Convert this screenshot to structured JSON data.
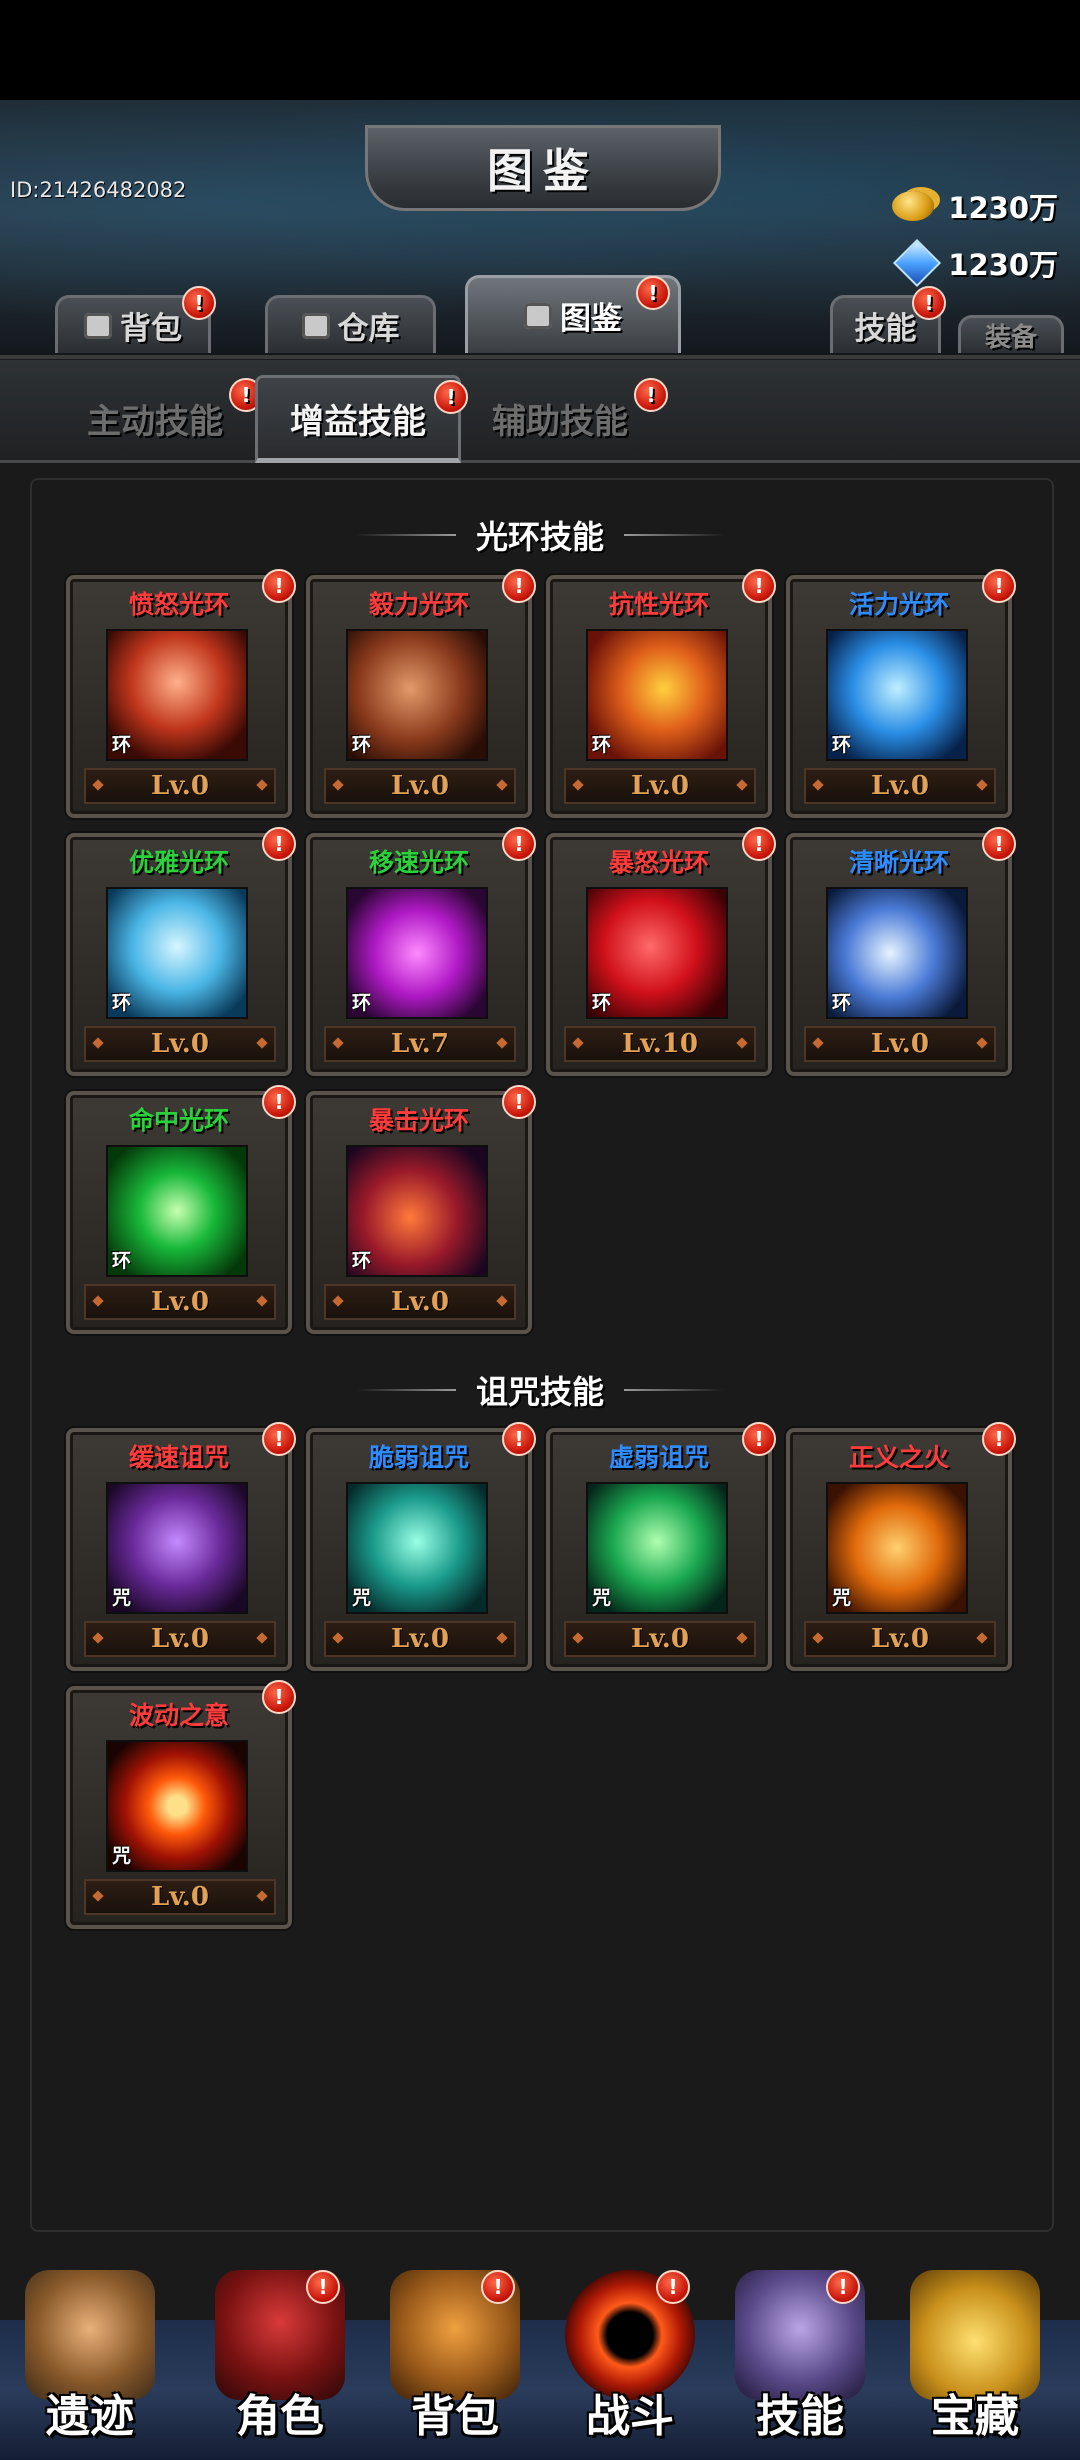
{
  "header": {
    "title": "图鉴",
    "player_id": "ID:21426482082",
    "gold": "1230万",
    "gems": "1230万"
  },
  "top_tabs": [
    {
      "label": "背包",
      "badge": "!"
    },
    {
      "label": "仓库"
    },
    {
      "label": "图鉴",
      "badge": "!",
      "active": true
    },
    {
      "label": "技能",
      "badge": "!"
    },
    {
      "label": "装备"
    }
  ],
  "sub_tabs": [
    {
      "label": "主动技能",
      "badge": "!"
    },
    {
      "label": "增益技能",
      "badge": "!",
      "active": true
    },
    {
      "label": "辅助技能",
      "badge": "!"
    }
  ],
  "sections": [
    {
      "title": "光环技能",
      "skills": [
        {
          "name": "愤怒光环",
          "name_color": "#ff3b3b",
          "tag": "环",
          "level": "Lv.0",
          "badge": "!"
        },
        {
          "name": "毅力光环",
          "name_color": "#ff3b3b",
          "tag": "环",
          "level": "Lv.0",
          "badge": "!"
        },
        {
          "name": "抗性光环",
          "name_color": "#ff3b3b",
          "tag": "环",
          "level": "Lv.0",
          "badge": "!"
        },
        {
          "name": "活力光环",
          "name_color": "#2f8cff",
          "tag": "环",
          "level": "Lv.0",
          "badge": "!"
        },
        {
          "name": "优雅光环",
          "name_color": "#2bd13a",
          "tag": "环",
          "level": "Lv.0",
          "badge": "!"
        },
        {
          "name": "移速光环",
          "name_color": "#2bd13a",
          "tag": "环",
          "level": "Lv.7",
          "badge": "!"
        },
        {
          "name": "暴怒光环",
          "name_color": "#ff3b3b",
          "tag": "环",
          "level": "Lv.10",
          "badge": "!"
        },
        {
          "name": "清晰光环",
          "name_color": "#2f8cff",
          "tag": "环",
          "level": "Lv.0",
          "badge": "!"
        },
        {
          "name": "命中光环",
          "name_color": "#2bd13a",
          "tag": "环",
          "level": "Lv.0",
          "badge": "!"
        },
        {
          "name": "暴击光环",
          "name_color": "#ff3b3b",
          "tag": "环",
          "level": "Lv.0",
          "badge": "!"
        }
      ]
    },
    {
      "title": "诅咒技能",
      "skills": [
        {
          "name": "缓速诅咒",
          "name_color": "#ff3b3b",
          "tag": "咒",
          "level": "Lv.0",
          "badge": "!"
        },
        {
          "name": "脆弱诅咒",
          "name_color": "#2f8cff",
          "tag": "咒",
          "level": "Lv.0",
          "badge": "!"
        },
        {
          "name": "虚弱诅咒",
          "name_color": "#2f8cff",
          "tag": "咒",
          "level": "Lv.0",
          "badge": "!"
        },
        {
          "name": "正义之火",
          "name_color": "#ff3b3b",
          "tag": "咒",
          "level": "Lv.0",
          "badge": "!"
        },
        {
          "name": "波动之意",
          "name_color": "#ff3b3b",
          "tag": "咒",
          "level": "Lv.0",
          "badge": "!"
        }
      ]
    }
  ],
  "bottom_nav": [
    {
      "label": "遗迹"
    },
    {
      "label": "角色",
      "badge": "!"
    },
    {
      "label": "背包",
      "badge": "!"
    },
    {
      "label": "战斗",
      "badge": "!"
    },
    {
      "label": "技能",
      "badge": "!"
    },
    {
      "label": "宝藏"
    }
  ],
  "colors": {
    "background": "#1a1a1a",
    "level_text": "#e2a155",
    "badge": "#c8160a",
    "name_red": "#ff3b3b",
    "name_blue": "#2f8cff",
    "name_green": "#2bd13a"
  }
}
